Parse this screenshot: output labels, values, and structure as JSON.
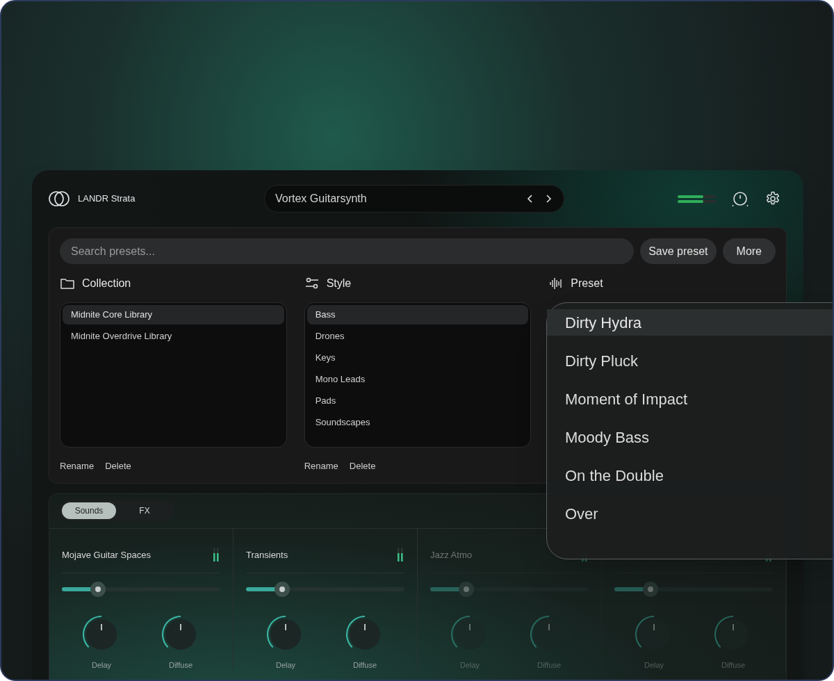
{
  "app": {
    "name": "LANDR Strata"
  },
  "preset_bar": {
    "name": "Vortex Guitarsynth"
  },
  "search": {
    "placeholder": "Search presets..."
  },
  "buttons": [
    "Save preset",
    "More"
  ],
  "columns": [
    {
      "kind": "folder",
      "title": "Collection",
      "items": [
        {
          "label": "Midnite Core Library",
          "selected": true
        },
        {
          "label": "Midnite Overdrive Library",
          "selected": false
        }
      ],
      "actions": [
        "Rename",
        "Delete"
      ]
    },
    {
      "kind": "sliders",
      "title": "Style",
      "items": [
        {
          "label": "Bass",
          "selected": true
        },
        {
          "label": "Drones",
          "selected": false
        },
        {
          "label": "Keys",
          "selected": false
        },
        {
          "label": "Mono Leads",
          "selected": false
        },
        {
          "label": "Pads",
          "selected": false
        },
        {
          "label": "Soundscapes",
          "selected": false
        }
      ],
      "actions": [
        "Rename",
        "Delete"
      ]
    },
    {
      "kind": "waveform",
      "title": "Preset"
    }
  ],
  "preset_dropdown": {
    "items": [
      {
        "label": "Dirty Hydra",
        "selected": true
      },
      {
        "label": "Dirty Pluck",
        "selected": false
      },
      {
        "label": "Moment of Impact",
        "selected": false
      },
      {
        "label": "Moody Bass",
        "selected": false
      },
      {
        "label": "On the Double",
        "selected": false
      },
      {
        "label": "Over",
        "selected": false
      }
    ]
  },
  "tabs": [
    {
      "label": "Sounds",
      "selected": true
    },
    {
      "label": "FX",
      "selected": false
    }
  ],
  "channels": [
    {
      "title": "Mojave Guitar Spaces",
      "dimmed": false,
      "level": 0.23,
      "knobs": [
        {
          "label": "Delay"
        },
        {
          "label": "Diffuse"
        }
      ]
    },
    {
      "title": "Transients",
      "dimmed": false,
      "level": 0.23,
      "knobs": [
        {
          "label": "Delay"
        },
        {
          "label": "Diffuse"
        }
      ]
    },
    {
      "title": "Jazz Atmo",
      "dimmed": true,
      "level": 0.23,
      "knobs": [
        {
          "label": "Delay"
        },
        {
          "label": "Diffuse"
        }
      ]
    },
    {
      "dimmed": true,
      "level": 0.23,
      "knobs": [
        {
          "label": "Delay"
        },
        {
          "label": "Diffuse"
        }
      ]
    }
  ]
}
